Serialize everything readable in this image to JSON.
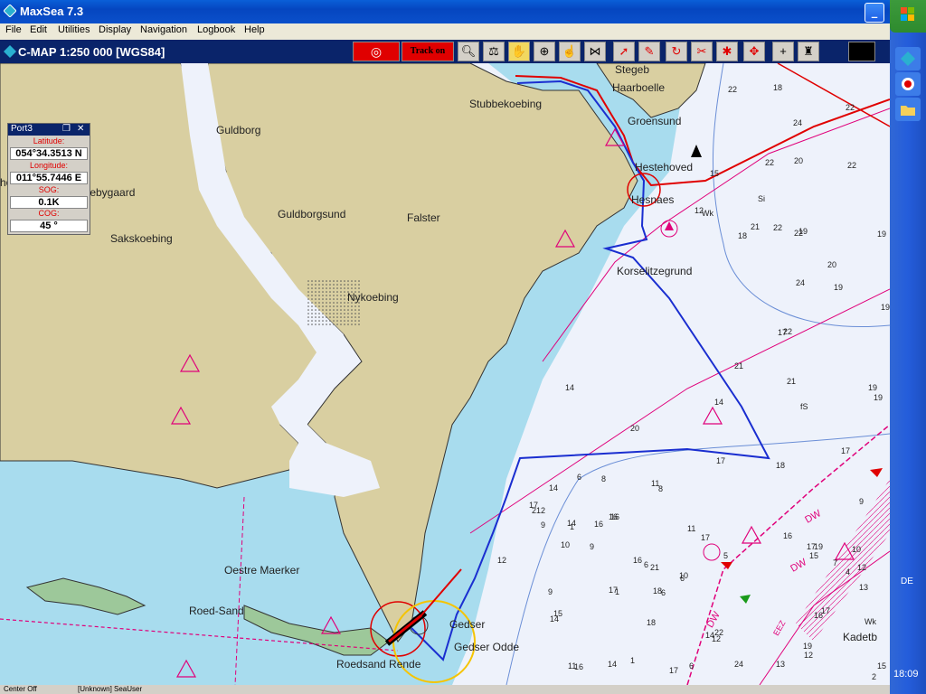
{
  "window": {
    "title": "MaxSea 7.3"
  },
  "menu": [
    "File",
    "Edit",
    "Utilities",
    "Display",
    "Navigation",
    "Logbook",
    "Help"
  ],
  "chart": {
    "title": "C-MAP  1:250 000 [WGS84]",
    "track_button": "Track on"
  },
  "port_panel": {
    "title": "Port3",
    "latitude_label": "Latitude:",
    "latitude": "054°34.3513 N",
    "longitude_label": "Longitude:",
    "longitude": "011°55.7446 E",
    "sog_label": "SOG:",
    "sog": "0.1K",
    "cog_label": "COG:",
    "cog": "45 °"
  },
  "places": {
    "stubbekoebing": "Stubbekoebing",
    "haarboelle": "Haarboelle",
    "groensund": "Groensund",
    "hestehoved": "Hestehoved",
    "hesnaes": "Hesnaes",
    "korselitzegrund": "Korselitzegrund",
    "guldborg": "Guldborg",
    "orebygaard": "Orebygaard",
    "guldborgsund": "Guldborgsund",
    "falster": "Falster",
    "sakskoebing": "Sakskoebing",
    "nykoebing": "Nykoebing",
    "holm": "holm",
    "oestre_maerker": "Oestre Maerker",
    "roed_sand": "Roed-Sand",
    "roedsand_rende": "Roedsand Rende",
    "gedser": "Gedser",
    "gedser_odde": "Gedser Odde",
    "kadetb": "Kadetb",
    "stegeb": "Stegeb"
  },
  "zone_labels": {
    "dw1": "DW",
    "dw2": "DW",
    "dw3": "DW",
    "eez": "EEZ"
  },
  "depths": [
    "18",
    "22",
    "24",
    "22",
    "22",
    "20",
    "22",
    "15",
    "22",
    "12",
    "Wk",
    "18",
    "21",
    "22",
    "19",
    "Si",
    "19",
    "20",
    "24",
    "19",
    "19",
    "17",
    "22",
    "21",
    "14",
    "14",
    "19",
    "19",
    "21",
    "fS",
    "17",
    "20",
    "18",
    "14",
    "17",
    "6",
    "8",
    "12",
    "16",
    "9",
    "16",
    "11",
    "8",
    "17",
    "2",
    "14",
    "1",
    "9",
    "12",
    "10",
    "9",
    "16",
    "9",
    "17",
    "15",
    "14",
    "18",
    "1",
    "6",
    "21",
    "10",
    "6",
    "18",
    "6",
    "11",
    "16",
    "14",
    "1",
    "17",
    "6",
    "14",
    "12",
    "11",
    "17",
    "5",
    "16",
    "16",
    "17",
    "19",
    "15",
    "16",
    "17",
    "12",
    "22",
    "24",
    "13",
    "2",
    "15",
    "19",
    "10",
    "4",
    "12",
    "13",
    "7",
    "Wk"
  ],
  "status": {
    "left": "Center Off",
    "user": "[Unknown] SeaUser"
  },
  "taskbar": {
    "lang": "DE",
    "clock": "18:09"
  },
  "colors": {
    "land": "#D9CFA1",
    "shallow": "#A8DCEE",
    "deep": "#EEF2FB",
    "track": "#1A2ED0",
    "route": "#E00000",
    "boundary": "#E0007A"
  }
}
